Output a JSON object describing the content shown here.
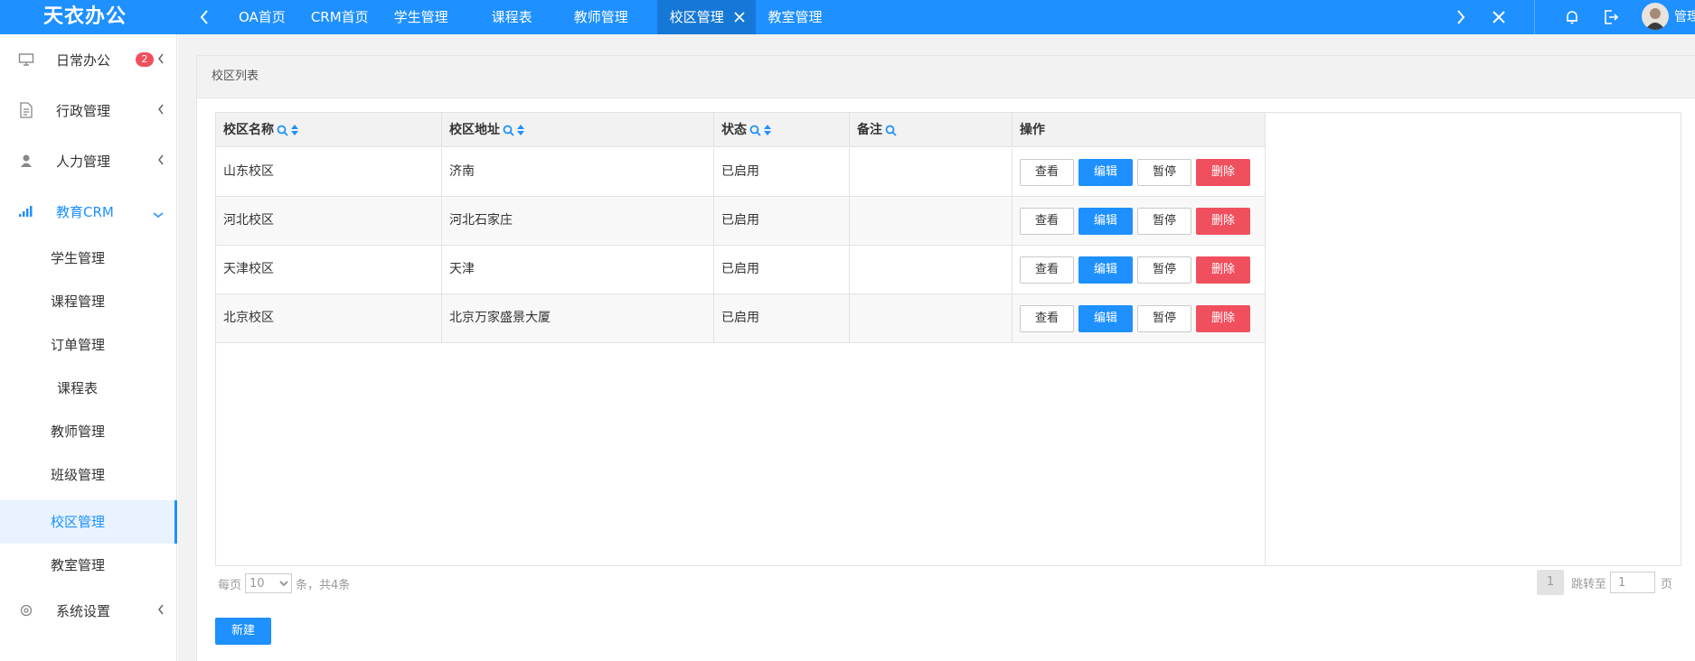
{
  "app": {
    "logo": "天衣办公"
  },
  "topbar": {
    "tabs": [
      {
        "label": "OA首页"
      },
      {
        "label": "CRM首页"
      },
      {
        "label": "学生管理"
      },
      {
        "label": "课程表"
      },
      {
        "label": "教师管理"
      },
      {
        "label": "校区管理",
        "active": true
      },
      {
        "label": "教室管理"
      }
    ],
    "user": {
      "name": "管理员"
    }
  },
  "sidebar": {
    "items": [
      {
        "label": "日常办公",
        "icon": "monitor-icon",
        "badge": "2"
      },
      {
        "label": "行政管理",
        "icon": "document-icon"
      },
      {
        "label": "人力管理",
        "icon": "user-icon"
      },
      {
        "label": "教育CRM",
        "icon": "signal-icon",
        "open": true,
        "children": [
          {
            "label": "学生管理"
          },
          {
            "label": "课程管理"
          },
          {
            "label": "订单管理"
          },
          {
            "label": "课程表"
          },
          {
            "label": "教师管理"
          },
          {
            "label": "班级管理"
          },
          {
            "label": "校区管理",
            "active": true
          },
          {
            "label": "教室管理"
          }
        ]
      },
      {
        "label": "系统设置",
        "icon": "gear-icon"
      }
    ]
  },
  "panel": {
    "title": "校区列表"
  },
  "table": {
    "columns": [
      "校区名称",
      "校区地址",
      "状态",
      "备注",
      "操作"
    ],
    "rows": [
      {
        "name": "山东校区",
        "address": "济南",
        "status": "已启用",
        "note": ""
      },
      {
        "name": "河北校区",
        "address": "河北石家庄",
        "status": "已启用",
        "note": ""
      },
      {
        "name": "天津校区",
        "address": "天津",
        "status": "已启用",
        "note": ""
      },
      {
        "name": "北京校区",
        "address": "北京万家盛景大厦",
        "status": "已启用",
        "note": ""
      }
    ],
    "actions": {
      "view": "查看",
      "edit": "编辑",
      "pause": "暂停",
      "delete": "删除"
    }
  },
  "pager": {
    "per_page_prefix": "每页",
    "per_page_value": "10",
    "per_page_suffix": "条，共4条",
    "current_page": "1",
    "jump_label": "跳转至",
    "jump_value": "1",
    "page_unit": "页"
  },
  "actions": {
    "new_label": "新建"
  },
  "colors": {
    "primary": "#1e90ff",
    "danger": "#f0505e",
    "badge": "#f0505e"
  }
}
